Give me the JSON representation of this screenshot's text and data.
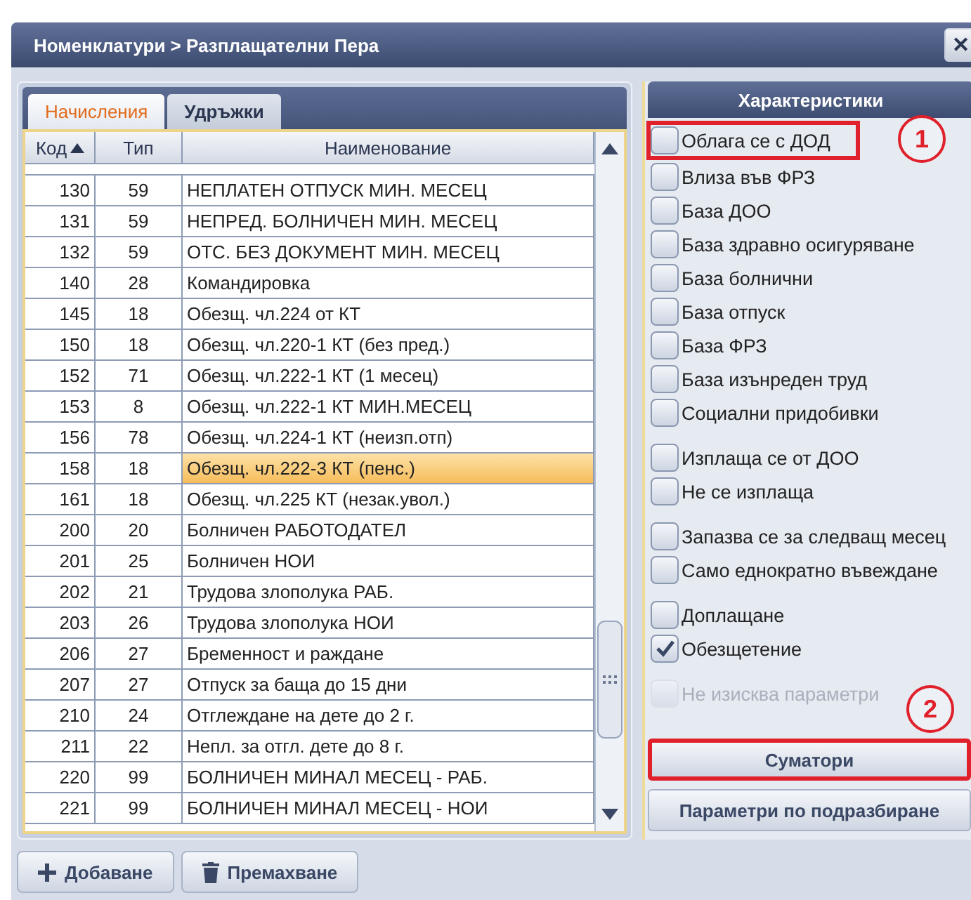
{
  "window": {
    "title": "Номенклатури > Разплащателни Пера",
    "close": "✕"
  },
  "tabs": [
    {
      "label": "Начисления",
      "selected": true
    },
    {
      "label": "Удръжки",
      "selected": false
    }
  ],
  "table": {
    "columns": [
      {
        "label": "Код",
        "sorted_ascending": true
      },
      {
        "label": "Тип"
      },
      {
        "label": "Наименование"
      }
    ],
    "rows": [
      {
        "code": "130",
        "type": "59",
        "name": "НЕПЛАТЕН ОТПУСК МИН. МЕСЕЦ",
        "selected": false
      },
      {
        "code": "131",
        "type": "59",
        "name": "НЕПРЕД. БОЛНИЧЕН МИН. МЕСЕЦ",
        "selected": false
      },
      {
        "code": "132",
        "type": "59",
        "name": "ОТС. БЕЗ ДОКУМЕНТ МИН. МЕСЕЦ",
        "selected": false
      },
      {
        "code": "140",
        "type": "28",
        "name": "Командировка",
        "selected": false
      },
      {
        "code": "145",
        "type": "18",
        "name": "Обезщ. чл.224 от КТ",
        "selected": false
      },
      {
        "code": "150",
        "type": "18",
        "name": "Обезщ. чл.220-1 КТ (без пред.)",
        "selected": false
      },
      {
        "code": "152",
        "type": "71",
        "name": "Обезщ. чл.222-1 КТ (1 месец)",
        "selected": false
      },
      {
        "code": "153",
        "type": "8",
        "name": "Обезщ. чл.222-1 КТ МИН.МЕСЕЦ",
        "selected": false
      },
      {
        "code": "156",
        "type": "78",
        "name": "Обезщ. чл.224-1 КТ (неизп.отп)",
        "selected": false
      },
      {
        "code": "158",
        "type": "18",
        "name": "Обезщ. чл.222-3 КТ (пенс.)",
        "selected": true
      },
      {
        "code": "161",
        "type": "18",
        "name": "Обезщ. чл.225 КТ (незак.увол.)",
        "selected": false
      },
      {
        "code": "200",
        "type": "20",
        "name": "Болничен РАБОТОДАТЕЛ",
        "selected": false
      },
      {
        "code": "201",
        "type": "25",
        "name": "Болничен НОИ",
        "selected": false
      },
      {
        "code": "202",
        "type": "21",
        "name": "Трудова злополука РАБ.",
        "selected": false
      },
      {
        "code": "203",
        "type": "26",
        "name": "Трудова злополука НОИ",
        "selected": false
      },
      {
        "code": "206",
        "type": "27",
        "name": "Бременност и раждане",
        "selected": false
      },
      {
        "code": "207",
        "type": "27",
        "name": "Отпуск за баща до 15 дни",
        "selected": false
      },
      {
        "code": "210",
        "type": "24",
        "name": "Отглеждане на дете до 2 г.",
        "selected": false
      },
      {
        "code": "211",
        "type": "22",
        "name": "Непл. за отгл. дете до 8 г.",
        "selected": false
      },
      {
        "code": "220",
        "type": "99",
        "name": "БОЛНИЧЕН МИНАЛ МЕСЕЦ - РАБ.",
        "selected": false
      },
      {
        "code": "221",
        "type": "99",
        "name": "БОЛНИЧЕН МИНАЛ МЕСЕЦ - НОИ",
        "selected": false
      }
    ]
  },
  "actions": [
    {
      "label": "Добаване",
      "kind": "add"
    },
    {
      "label": "Премахване",
      "kind": "remove"
    }
  ],
  "characteristics": {
    "title": "Характеристики",
    "groups": [
      [
        {
          "label": "Облага се с ДОД",
          "checked": false,
          "disabled": false,
          "annotation": "1"
        },
        {
          "label": "Влиза във ФРЗ",
          "checked": false,
          "disabled": false
        },
        {
          "label": "База ДОО",
          "checked": false,
          "disabled": false
        },
        {
          "label": "База здравно осигуряване",
          "checked": false,
          "disabled": false
        },
        {
          "label": "База болнични",
          "checked": false,
          "disabled": false
        },
        {
          "label": "База отпуск",
          "checked": false,
          "disabled": false
        },
        {
          "label": "База ФРЗ",
          "checked": false,
          "disabled": false
        },
        {
          "label": "База изънреден труд",
          "checked": false,
          "disabled": false
        },
        {
          "label": "Социални придобивки",
          "checked": false,
          "disabled": false
        }
      ],
      [
        {
          "label": "Изплаща се от ДОО",
          "checked": false,
          "disabled": false
        },
        {
          "label": "Не се изплаща",
          "checked": false,
          "disabled": false
        }
      ],
      [
        {
          "label": "Запазва се за следващ месец",
          "checked": false,
          "disabled": false
        },
        {
          "label": "Само еднократно въвеждане",
          "checked": false,
          "disabled": false
        }
      ],
      [
        {
          "label": "Доплащане",
          "checked": false,
          "disabled": false
        },
        {
          "label": "Обезщетение",
          "checked": true,
          "disabled": false
        }
      ],
      [
        {
          "label": "Не изисква параметри",
          "checked": false,
          "disabled": true
        }
      ]
    ],
    "buttons": [
      {
        "label": "Суматори",
        "annotation": "2"
      },
      {
        "label": "Параметри по подразбиране"
      }
    ]
  }
}
